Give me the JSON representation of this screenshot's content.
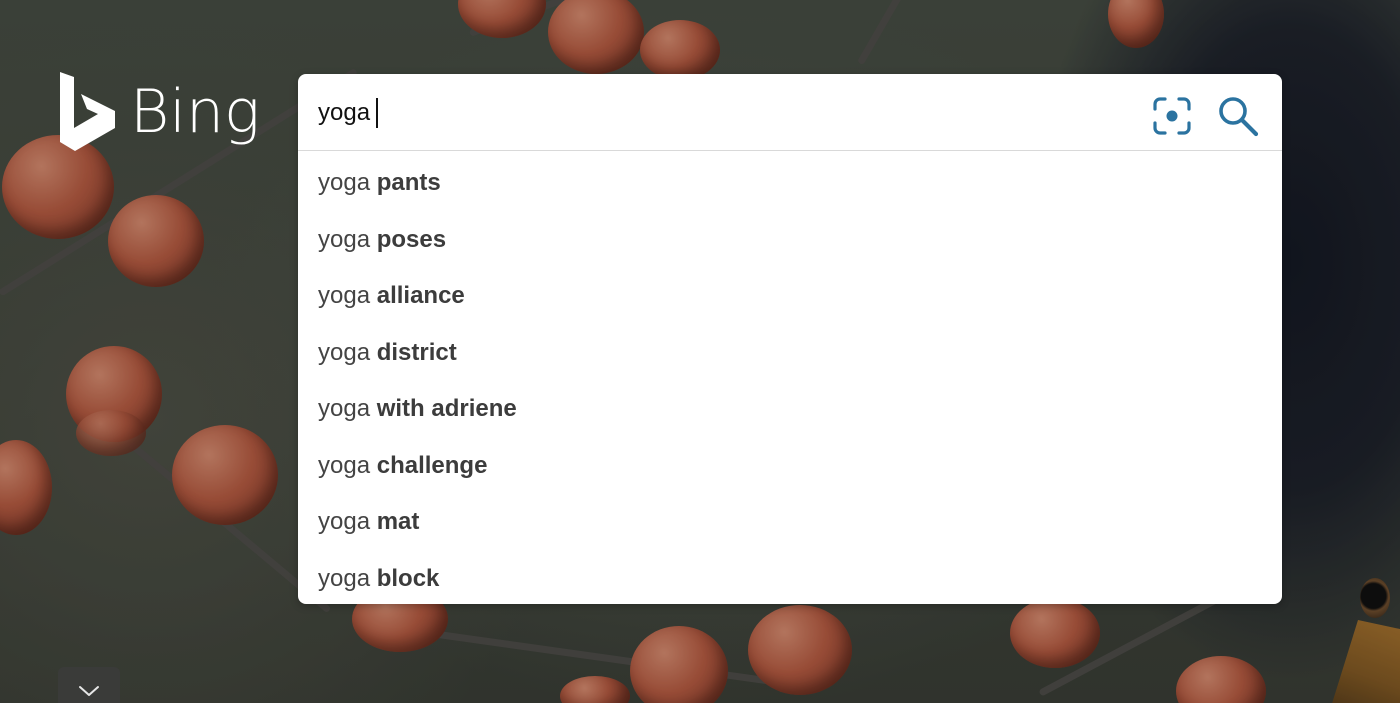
{
  "logo": {
    "text": "Bing"
  },
  "search": {
    "query": "yoga",
    "visual_search_icon": "visual-search-icon",
    "search_icon": "search-icon",
    "accent_color": "#2b73a0"
  },
  "suggestions": [
    {
      "prefix": "yoga",
      "completion": "pants"
    },
    {
      "prefix": "yoga",
      "completion": "poses"
    },
    {
      "prefix": "yoga",
      "completion": "alliance"
    },
    {
      "prefix": "yoga",
      "completion": "district"
    },
    {
      "prefix": "yoga",
      "completion": "with adriene"
    },
    {
      "prefix": "yoga",
      "completion": "challenge"
    },
    {
      "prefix": "yoga",
      "completion": "mat"
    },
    {
      "prefix": "yoga",
      "completion": "block"
    }
  ],
  "scroll_button": {
    "icon": "chevron-down-icon"
  }
}
